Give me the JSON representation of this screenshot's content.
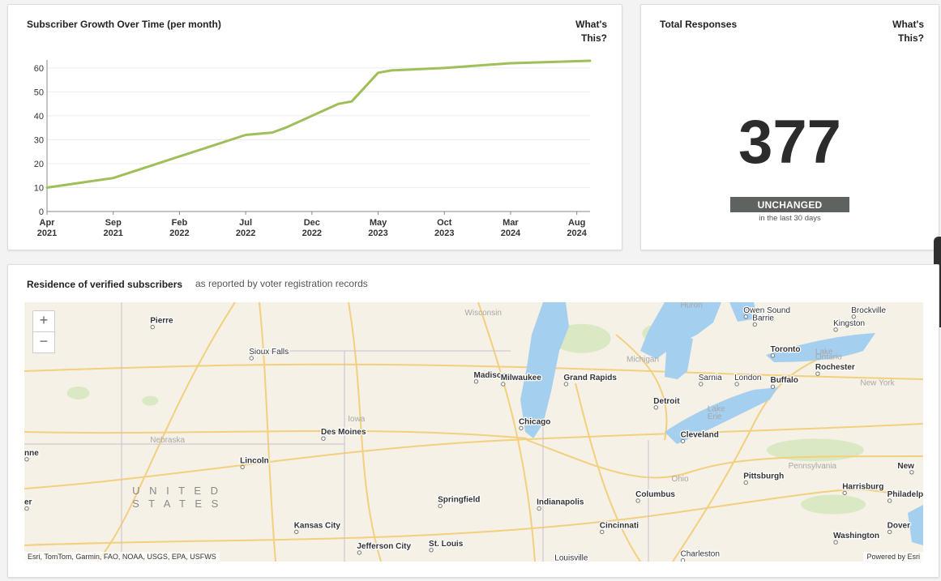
{
  "growth": {
    "title": "Subscriber Growth Over Time (per month)",
    "whats_this": [
      "What's",
      "This?"
    ],
    "chart_data": {
      "type": "line",
      "title": "Subscriber Growth Over Time (per month)",
      "xlabel": "",
      "ylabel": "",
      "ylim": [
        0,
        62
      ],
      "yticks": [
        0,
        10,
        20,
        30,
        40,
        50,
        60
      ],
      "xlim": [
        "2021-04",
        "2024-09"
      ],
      "xticks": [
        {
          "t": "2021-04",
          "label": [
            "Apr",
            "2021"
          ]
        },
        {
          "t": "2021-09",
          "label": [
            "Sep",
            "2021"
          ]
        },
        {
          "t": "2022-02",
          "label": [
            "Feb",
            "2022"
          ]
        },
        {
          "t": "2022-07",
          "label": [
            "Jul",
            "2022"
          ]
        },
        {
          "t": "2022-12",
          "label": [
            "Dec",
            "2022"
          ]
        },
        {
          "t": "2023-05",
          "label": [
            "May",
            "2023"
          ]
        },
        {
          "t": "2023-10",
          "label": [
            "Oct",
            "2023"
          ]
        },
        {
          "t": "2024-03",
          "label": [
            "Mar",
            "2024"
          ]
        },
        {
          "t": "2024-08",
          "label": [
            "Aug",
            "2024"
          ]
        }
      ],
      "grid": true,
      "series": [
        {
          "color": "#9ebf5a",
          "points": [
            [
              "2021-04",
              10
            ],
            [
              "2021-09",
              14
            ],
            [
              "2022-02",
              23
            ],
            [
              "2022-07",
              32
            ],
            [
              "2022-09",
              33
            ],
            [
              "2022-10",
              35
            ],
            [
              "2023-02",
              45
            ],
            [
              "2023-03",
              46
            ],
            [
              "2023-05",
              58
            ],
            [
              "2023-06",
              59
            ],
            [
              "2023-10",
              60
            ],
            [
              "2024-03",
              62
            ],
            [
              "2024-09",
              63
            ]
          ]
        }
      ]
    }
  },
  "responses": {
    "title": "Total Responses",
    "whats_this": [
      "What's",
      "This?"
    ],
    "value": "377",
    "status": "UNCHANGED",
    "status_sub": "in the last 30 days"
  },
  "map": {
    "title": "Residence of verified subscribers",
    "subtitle": "as reported by voter registration records",
    "zoom_in": "+",
    "zoom_out": "−",
    "attribution_left": "Esri, TomTom, Garmin, FAO, NOAA, USGS, EPA, USFWS",
    "attribution_right": "Powered by Esri",
    "water_color": "#a4cfee",
    "land_color": "#f5f1e6",
    "road_color": "#f3cf7e",
    "places": [
      {
        "name": "Pierre",
        "bold": true
      },
      {
        "name": "Sioux Falls",
        "bold": false
      },
      {
        "name": "Wisconsin",
        "bold": false,
        "region": true
      },
      {
        "name": "Madison",
        "bold": true
      },
      {
        "name": "Milwaukee",
        "bold": true
      },
      {
        "name": "Grand Rapids",
        "bold": true
      },
      {
        "name": "Michigan",
        "bold": false,
        "region": true
      },
      {
        "name": "Huron",
        "bold": false,
        "region": true
      },
      {
        "name": "Owen Sound",
        "bold": false
      },
      {
        "name": "Barrie",
        "bold": false
      },
      {
        "name": "Brockville",
        "bold": false
      },
      {
        "name": "Kingston",
        "bold": false
      },
      {
        "name": "Toronto",
        "bold": true
      },
      {
        "name": "Lake",
        "bold": false,
        "region": true
      },
      {
        "name": "Ontario",
        "bold": false,
        "region": true
      },
      {
        "name": "Rochester",
        "bold": true
      },
      {
        "name": "Sarnia",
        "bold": false
      },
      {
        "name": "London",
        "bold": false
      },
      {
        "name": "Buffalo",
        "bold": true
      },
      {
        "name": "New York",
        "bold": false,
        "region": true
      },
      {
        "name": "Detroit",
        "bold": true
      },
      {
        "name": "Iowa",
        "bold": false,
        "region": true
      },
      {
        "name": "Des Moines",
        "bold": true
      },
      {
        "name": "Chicago",
        "bold": true
      },
      {
        "name": "Lake",
        "bold": false,
        "region": true
      },
      {
        "name": "Erie",
        "bold": false,
        "region": true
      },
      {
        "name": "Cleveland",
        "bold": true
      },
      {
        "name": "Nebraska",
        "bold": false,
        "region": true
      },
      {
        "name": "nne",
        "bold": true
      },
      {
        "name": "Lincoln",
        "bold": true
      },
      {
        "name": "Ohio",
        "bold": false,
        "region": true
      },
      {
        "name": "Pennsylvania",
        "bold": false,
        "region": true
      },
      {
        "name": "New",
        "bold": true
      },
      {
        "name": "Pittsburgh",
        "bold": true
      },
      {
        "name": "U N I T E D",
        "bold": false,
        "country": true
      },
      {
        "name": "S T A T E S",
        "bold": false,
        "country": true
      },
      {
        "name": "Harrisburg",
        "bold": true
      },
      {
        "name": "Philadelphia",
        "bold": true
      },
      {
        "name": "Columbus",
        "bold": true
      },
      {
        "name": "Springfield",
        "bold": true
      },
      {
        "name": "Indianapolis",
        "bold": true
      },
      {
        "name": "Kansas City",
        "bold": true
      },
      {
        "name": "Cincinnati",
        "bold": true
      },
      {
        "name": "Dover",
        "bold": true
      },
      {
        "name": "Washington",
        "bold": true
      },
      {
        "name": "Jefferson City",
        "bold": true
      },
      {
        "name": "St. Louis",
        "bold": true
      },
      {
        "name": "Louisville",
        "bold": false
      },
      {
        "name": "Charleston",
        "bold": false
      },
      {
        "name": "er",
        "bold": true
      }
    ]
  }
}
